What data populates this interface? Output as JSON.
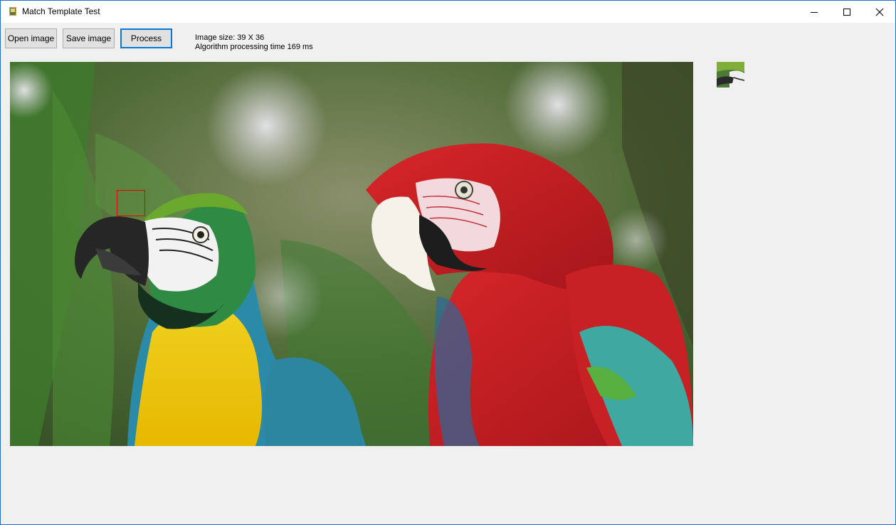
{
  "window": {
    "title": "Match Template Test",
    "controls": [
      "minimize-icon",
      "maximize-icon",
      "close-icon"
    ]
  },
  "toolbar": {
    "open_label": "Open image",
    "save_label": "Save image",
    "process_label": "Process"
  },
  "info": {
    "image_size": "Image size: 39 X 36",
    "processing_time": "Algorithm processing time 169 ms"
  },
  "image": {
    "content": "photo-two-macaws",
    "match_highlight_color": "#e00000"
  },
  "template_preview": {
    "content": "template-thumbnail"
  },
  "colors": {
    "accent": "#0078d7",
    "window_border": "#1e6fd0",
    "background": "#f0f0f0"
  }
}
